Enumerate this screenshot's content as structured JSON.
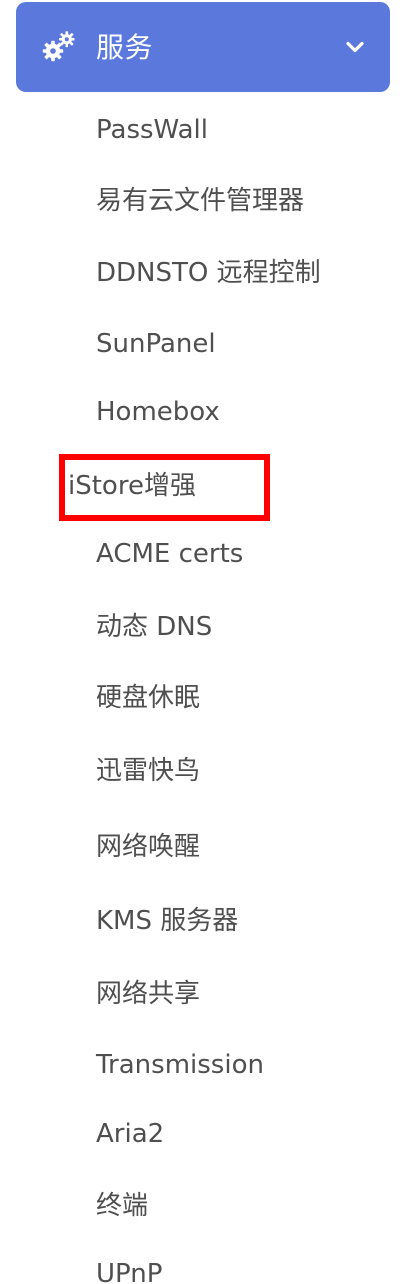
{
  "theme": {
    "header_bg": "#5b79dc",
    "header_text": "#ffffff",
    "item_text": "#4f4f4f",
    "highlight": "#ff0000"
  },
  "menu": {
    "header": {
      "icon": "gears-icon",
      "label": "服务",
      "toggle_icon": "chevron-down-icon"
    },
    "items": [
      {
        "label": "PassWall"
      },
      {
        "label": "易有云文件管理器"
      },
      {
        "label": "DDNSTO 远程控制"
      },
      {
        "label": "SunPanel"
      },
      {
        "label": "Homebox"
      },
      {
        "label": "iStore增强",
        "highlighted": true
      },
      {
        "label": "ACME certs"
      },
      {
        "label": "动态 DNS"
      },
      {
        "label": "硬盘休眠"
      },
      {
        "label": "迅雷快鸟"
      },
      {
        "label": "网络唤醒"
      },
      {
        "label": "KMS 服务器"
      },
      {
        "label": "网络共享"
      },
      {
        "label": "Transmission"
      },
      {
        "label": "Aria2"
      },
      {
        "label": "终端"
      },
      {
        "label": "UPnP"
      }
    ]
  }
}
